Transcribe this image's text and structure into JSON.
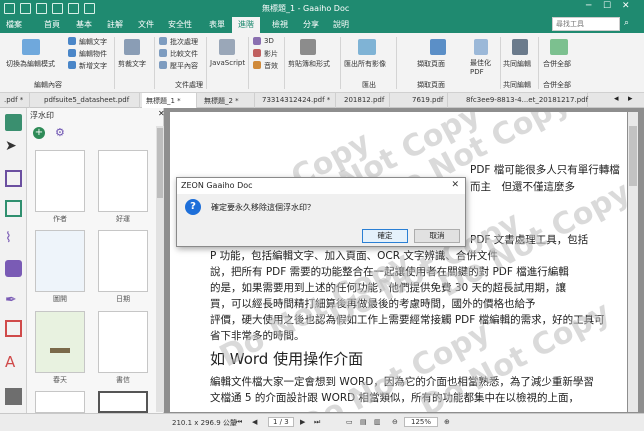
{
  "titlebar": {
    "title": "無標題_1 - Gaaiho Doc"
  },
  "menu": [
    "檔案",
    "首頁",
    "基本",
    "註解",
    "文件",
    "安全性",
    "表單",
    "進階",
    "檢視",
    "分享",
    "說明"
  ],
  "menu_active_index": 7,
  "search": {
    "placeholder": "尋找工具"
  },
  "ribbon": {
    "group1": {
      "big": "切換為編輯模式",
      "items": [
        "編輯文字",
        "編輯物件",
        "新增文字"
      ],
      "caption": "編輯內容"
    },
    "group2": {
      "big": "剪裁文字"
    },
    "group3": {
      "items": [
        "批次處理",
        "比較文件",
        "壓平內容"
      ],
      "caption": "文件處理"
    },
    "group4": {
      "big": "JavaScript"
    },
    "group5": {
      "items": [
        "3D",
        "影片",
        "音效"
      ]
    },
    "group6": {
      "big": "剪貼簿和形式"
    },
    "group7": {
      "big": "匯出所有影像",
      "caption": "匯出"
    },
    "group8": {
      "big": "擷取頁面",
      "caption": "擷取頁面"
    },
    "group9": {
      "big": "最佳化PDF"
    },
    "group10": {
      "big": "共同編輯",
      "caption": "共同編輯"
    },
    "group11": {
      "big": "合併全部",
      "caption": "合併全部"
    }
  },
  "tabs": [
    ".pdf *",
    "pdfsuite5_datasheet.pdf",
    "無標題_1 *",
    "無標題_2 *",
    "73314312424.pdf *",
    "201812.pdf",
    "7619.pdf",
    "8fc3ee9-8813-4...et_20181217.pdf"
  ],
  "panel": {
    "title": "浮水印",
    "thumbs": [
      "作者",
      "好運",
      "圖開",
      "日期",
      "春天",
      "書信"
    ]
  },
  "document": {
    "lines": [
      "PDF 檔可能很多人只有單行轉檔",
      "而主　但還不僅這麼多",
      "PDF 文書處理工具，包括",
      "P 功能，包括編輯文字、加入頁面、OCR 文字辨識、合併文件",
      "說，把所有 PDF 需要的功能整合在一起讓使用者在關鍵的對 PDF 檔進行編輯",
      "的是，如果需要用到上述的任何功能，他們提供免費 30 天的超長試用期，讓",
      "買，可以經長時間精打細算後再做最後的考慮時間，國外的價格也給予",
      "評價，硬大使用之後也認為假如工作上需要經常接觸 PDF 檔編輯的需求，好的工具可",
      "省下非常多的時間。",
      "如 Word 使用操作介面",
      "編輯文件檔大家一定會想到 WORD，因為它的介面也相當熟悉，為了減少重新學習",
      "文檔通 5 的介面設計跟 WORD 相當類似，所有的功能都集中在以檢視的上面，"
    ],
    "watermark_text": "Do Not Copy"
  },
  "status": {
    "size": "210.1 x 296.9 公釐",
    "page": "1 / 3",
    "zoom": "125%"
  },
  "dialog": {
    "title": "ZEON Gaaiho Doc",
    "message": "確定要永久移除這個浮水印？",
    "ok": "確定",
    "cancel": "取消",
    "close": "✕"
  }
}
